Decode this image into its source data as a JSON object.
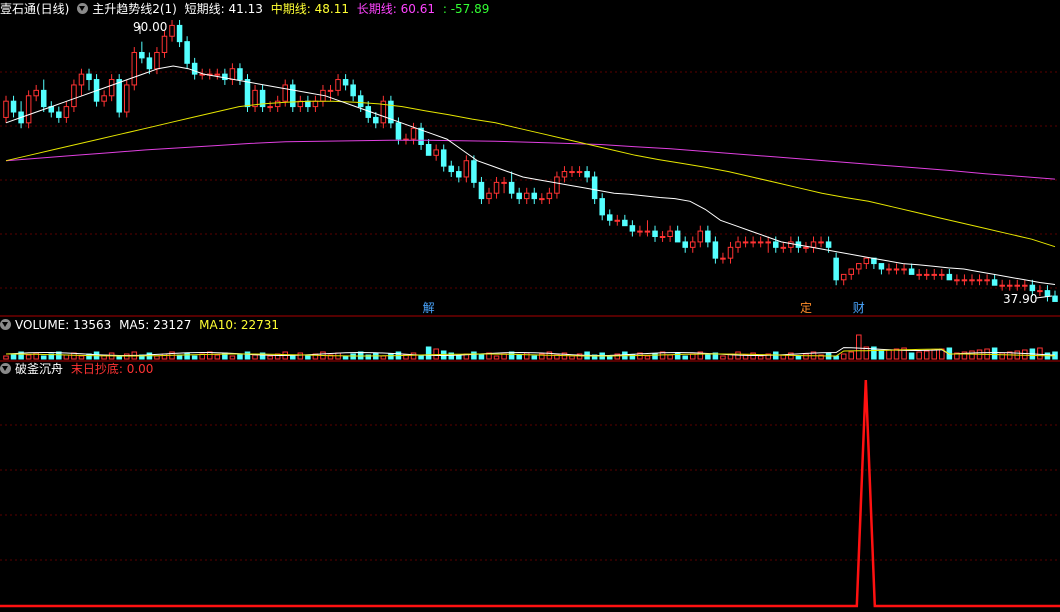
{
  "main": {
    "app_title": "壹石通(日线)",
    "indicator_name": "主升趋势线2(1)",
    "short_label": "短期线:",
    "short_value": "41.13",
    "mid_label": "中期线:",
    "mid_value": "48.11",
    "long_label": "长期线:",
    "long_value": "60.61",
    "extra_value": ": -57.89",
    "high_label": "90.00",
    "low_label": "37.90",
    "markers": [
      {
        "text": "解",
        "color": "#4aa6ff",
        "bar": 56
      },
      {
        "text": "定",
        "color": "#ff8c2a",
        "bar": 106
      },
      {
        "text": "财",
        "color": "#4aa6ff",
        "bar": 113
      }
    ]
  },
  "volume": {
    "title": "VOLUME: 13563",
    "ma5": "MA5: 23127",
    "ma10": "MA10: 22731"
  },
  "lower": {
    "title": "破釜沉舟",
    "series_label": "末日抄底: 0.00"
  },
  "colors": {
    "up": "#ff3333",
    "down": "#54ffff",
    "ma_short": "#ffffff",
    "ma_mid": "#e6e600",
    "ma_long": "#e040e0",
    "mid_text": "#ffff33",
    "long_text": "#ff44ff",
    "extra_text": "#33ff33",
    "signal": "#ff1111",
    "grid": "#5a0000"
  },
  "chart_data": [
    {
      "type": "candlestick",
      "title": "主升趋势线2(1)",
      "ylim": [
        37.9,
        90.0
      ],
      "series_names": [
        "短期线",
        "中期线",
        "长期线"
      ],
      "ohlc": [
        [
          72,
          76,
          71,
          75
        ],
        [
          75,
          76,
          72,
          73
        ],
        [
          73,
          75,
          70,
          71
        ],
        [
          71,
          77,
          70,
          76
        ],
        [
          76,
          78,
          75,
          77
        ],
        [
          77,
          79,
          73,
          74
        ],
        [
          74,
          75,
          72,
          73
        ],
        [
          73,
          74,
          71,
          72
        ],
        [
          72,
          75,
          71,
          74
        ],
        [
          74,
          79,
          73,
          78
        ],
        [
          78,
          81,
          76,
          80
        ],
        [
          80,
          81,
          77,
          79
        ],
        [
          79,
          80,
          74,
          75
        ],
        [
          75,
          77,
          74,
          76
        ],
        [
          76,
          80,
          75,
          79
        ],
        [
          79,
          80,
          72,
          73
        ],
        [
          73,
          79,
          72,
          78
        ],
        [
          78,
          85,
          77,
          84
        ],
        [
          84,
          86,
          82,
          83
        ],
        [
          83,
          84,
          80,
          81
        ],
        [
          81,
          85,
          80,
          84
        ],
        [
          84,
          88,
          83,
          87
        ],
        [
          87,
          90,
          86,
          89
        ],
        [
          89,
          90,
          85,
          86
        ],
        [
          86,
          87,
          81,
          82
        ],
        [
          82,
          83,
          79,
          80
        ],
        [
          80,
          81,
          79,
          80
        ],
        [
          80,
          81,
          79,
          80
        ],
        [
          80,
          81,
          79,
          80
        ],
        [
          80,
          81,
          78,
          79
        ],
        [
          79,
          82,
          78,
          81
        ],
        [
          81,
          82,
          78,
          79
        ],
        [
          79,
          80,
          73,
          74
        ],
        [
          74,
          78,
          73,
          77
        ],
        [
          77,
          78,
          73,
          74
        ],
        [
          74,
          75,
          73,
          74
        ],
        [
          74,
          76,
          73,
          75
        ],
        [
          75,
          79,
          74,
          78
        ],
        [
          78,
          79,
          73,
          74
        ],
        [
          74,
          76,
          73,
          75
        ],
        [
          75,
          76,
          73,
          74
        ],
        [
          74,
          76,
          73,
          75
        ],
        [
          75,
          78,
          74,
          77
        ],
        [
          77,
          78,
          75,
          77
        ],
        [
          77,
          80,
          76,
          79
        ],
        [
          79,
          80,
          77,
          78
        ],
        [
          78,
          79,
          75,
          76
        ],
        [
          76,
          77,
          73,
          74
        ],
        [
          74,
          75,
          71,
          72
        ],
        [
          72,
          73,
          70,
          71
        ],
        [
          71,
          76,
          70,
          75
        ],
        [
          75,
          76,
          70,
          71
        ],
        [
          71,
          72,
          67,
          68
        ],
        [
          68,
          69,
          67,
          68
        ],
        [
          68,
          71,
          67,
          70
        ],
        [
          70,
          71,
          66,
          67
        ],
        [
          67,
          68,
          65,
          65
        ],
        [
          65,
          67,
          64,
          66
        ],
        [
          66,
          67,
          62,
          63
        ],
        [
          63,
          64,
          61,
          62
        ],
        [
          62,
          63,
          60,
          61
        ],
        [
          61,
          65,
          60,
          64
        ],
        [
          64,
          65,
          59,
          60
        ],
        [
          60,
          61,
          56,
          57
        ],
        [
          57,
          59,
          56,
          58
        ],
        [
          58,
          61,
          57,
          60
        ],
        [
          60,
          61,
          58,
          60
        ],
        [
          60,
          62,
          57,
          58
        ],
        [
          58,
          59,
          56,
          57
        ],
        [
          57,
          59,
          56,
          58
        ],
        [
          58,
          59,
          56,
          57
        ],
        [
          57,
          58,
          56,
          57
        ],
        [
          57,
          59,
          56,
          58
        ],
        [
          58,
          62,
          57,
          61
        ],
        [
          61,
          63,
          60,
          62
        ],
        [
          62,
          63,
          61,
          62
        ],
        [
          62,
          63,
          61,
          62
        ],
        [
          62,
          63,
          60,
          61
        ],
        [
          61,
          62,
          56,
          57
        ],
        [
          57,
          58,
          53,
          54
        ],
        [
          54,
          55,
          52,
          53
        ],
        [
          53,
          54,
          52,
          53
        ],
        [
          53,
          54,
          52,
          52
        ],
        [
          52,
          53,
          50,
          51
        ],
        [
          51,
          52,
          50,
          51
        ],
        [
          51,
          53,
          50,
          51
        ],
        [
          51,
          52,
          49,
          50
        ],
        [
          50,
          51,
          49,
          50
        ],
        [
          50,
          52,
          49,
          51
        ],
        [
          51,
          52,
          49,
          49
        ],
        [
          49,
          50,
          47,
          48
        ],
        [
          48,
          50,
          47,
          49
        ],
        [
          49,
          52,
          48,
          51
        ],
        [
          51,
          52,
          48,
          49
        ],
        [
          49,
          50,
          45,
          46
        ],
        [
          46,
          47,
          45,
          46
        ],
        [
          46,
          49,
          45,
          48
        ],
        [
          48,
          50,
          47,
          49
        ],
        [
          49,
          50,
          48,
          49
        ],
        [
          49,
          50,
          48,
          49
        ],
        [
          49,
          50,
          48,
          49
        ],
        [
          49,
          50,
          47,
          49
        ],
        [
          49,
          50,
          47,
          48
        ],
        [
          48,
          49,
          47,
          48
        ],
        [
          48,
          50,
          47,
          49
        ],
        [
          49,
          50,
          47,
          48
        ],
        [
          48,
          49,
          47,
          48
        ],
        [
          48,
          50,
          47,
          49
        ],
        [
          49,
          50,
          48,
          49
        ],
        [
          49,
          50,
          47,
          48
        ],
        [
          48,
          50,
          47,
          49
        ],
        [
          49,
          50,
          48,
          49
        ],
        [
          49,
          50,
          47,
          48
        ],
        [
          48,
          49,
          44,
          45
        ],
        [
          45,
          46,
          44,
          45
        ],
        [
          45,
          46,
          44,
          45
        ],
        [
          45,
          46,
          44,
          45
        ],
        [
          45,
          46,
          44,
          45
        ],
        [
          45,
          46,
          44,
          45
        ],
        [
          45,
          46,
          44,
          45
        ],
        [
          45,
          46,
          44,
          45
        ],
        [
          45,
          46,
          44,
          45
        ],
        [
          45,
          46,
          44,
          45
        ],
        [
          45,
          46,
          44,
          45
        ],
        [
          45,
          46,
          44,
          45
        ],
        [
          45,
          46,
          44,
          45
        ],
        [
          45,
          46,
          44,
          45
        ],
        [
          45,
          46,
          44,
          45
        ],
        [
          45,
          46,
          44,
          45
        ],
        [
          45,
          46,
          44,
          45
        ],
        [
          45,
          46,
          44,
          45
        ],
        [
          45,
          46,
          44,
          45
        ],
        [
          45,
          46,
          44,
          45
        ],
        [
          45,
          46,
          44,
          45
        ],
        [
          45,
          46,
          44,
          45
        ],
        [
          45,
          46,
          44,
          45
        ],
        [
          45,
          46,
          44,
          45
        ],
        [
          45,
          46,
          44,
          45
        ],
        [
          45,
          46,
          44,
          45
        ],
        [
          45,
          46,
          44,
          45
        ]
      ],
      "ohlc_tail": [
        [
          46,
          47,
          41,
          42
        ],
        [
          42,
          43,
          41,
          43
        ],
        [
          43,
          44,
          42,
          44
        ],
        [
          44,
          45,
          43,
          45
        ],
        [
          45,
          46,
          44,
          46
        ],
        [
          46,
          46,
          44,
          45
        ],
        [
          45,
          45,
          43,
          44
        ],
        [
          44,
          45,
          43,
          44
        ],
        [
          44,
          45,
          43,
          44
        ],
        [
          44,
          45,
          43,
          44
        ],
        [
          44,
          45,
          43,
          43
        ],
        [
          43,
          44,
          42,
          43
        ],
        [
          43,
          44,
          42,
          43
        ],
        [
          43,
          44,
          42,
          43
        ],
        [
          43,
          44,
          42,
          43
        ],
        [
          43,
          44,
          42,
          42
        ],
        [
          42,
          43,
          41,
          42
        ],
        [
          42,
          43,
          41,
          42
        ],
        [
          42,
          43,
          41,
          42
        ],
        [
          42,
          43,
          41,
          42
        ],
        [
          42,
          43,
          41,
          42
        ],
        [
          42,
          43,
          41,
          41
        ],
        [
          41,
          42,
          40,
          41
        ],
        [
          41,
          42,
          40,
          41
        ],
        [
          41,
          42,
          40,
          41
        ],
        [
          41,
          42,
          40,
          41
        ],
        [
          41,
          42,
          39,
          40
        ],
        [
          40,
          41,
          39,
          40
        ],
        [
          40,
          41,
          38,
          39
        ],
        [
          39,
          40,
          38,
          38
        ]
      ],
      "ma_short": [
        71.0,
        72.0,
        73.0,
        74.0,
        75.0,
        76.0,
        77.0,
        78.0,
        79.0,
        80.0,
        81.0,
        81.5,
        81.0,
        80.0,
        79.5,
        79.0,
        78.5,
        78.0,
        77.5,
        77.0,
        76.5,
        76.0,
        75.0,
        74.0,
        73.0,
        72.0,
        71.0,
        70.0,
        69.0,
        68.0,
        66.0,
        64.0,
        63.0,
        62.0,
        61.0,
        60.5,
        60.0,
        59.5,
        59.0,
        58.5,
        58.0,
        57.8,
        57.5,
        57.2,
        57.0,
        56.5,
        55.0,
        53.0,
        52.0,
        51.0,
        50.0,
        49.0,
        48.5,
        48.0,
        47.5,
        47.0,
        46.5,
        46.0,
        45.5,
        45.0,
        44.8,
        44.5,
        44.2,
        44.0,
        43.5,
        43.0,
        42.5,
        42.0,
        41.5,
        41.13
      ],
      "ma_mid": [
        64.0,
        65.0,
        66.0,
        67.0,
        68.0,
        69.0,
        70.0,
        71.0,
        72.0,
        73.0,
        74.0,
        74.5,
        74.8,
        75.0,
        75.0,
        74.8,
        74.5,
        74.0,
        73.2,
        72.5,
        71.7,
        71.0,
        70.0,
        69.0,
        68.0,
        67.0,
        66.0,
        65.0,
        64.2,
        63.5,
        62.8,
        62.0,
        61.0,
        60.0,
        59.0,
        58.0,
        57.2,
        56.5,
        55.5,
        54.5,
        53.5,
        52.5,
        51.5,
        50.5,
        49.5,
        48.11
      ],
      "ma_long": [
        64.0,
        64.5,
        65.0,
        65.5,
        66.0,
        66.4,
        66.8,
        67.2,
        67.5,
        67.6,
        67.7,
        67.8,
        67.8,
        67.7,
        67.6,
        67.4,
        67.2,
        67.0,
        66.6,
        66.2,
        65.7,
        65.2,
        64.7,
        64.2,
        63.7,
        63.2,
        62.7,
        62.2,
        61.6,
        61.1,
        60.61
      ]
    },
    {
      "type": "bar",
      "title": "VOLUME: 13563",
      "series_names": [
        "VOLUME",
        "MA5",
        "MA10"
      ],
      "last_values": {
        "VOLUME": 13563,
        "MA5": 23127,
        "MA10": 22731
      }
    },
    {
      "type": "line",
      "title": "破釜沉舟",
      "series_names": [
        "末日抄底"
      ],
      "baseline": 0,
      "spike_bar": 113,
      "spike_value": 100,
      "last_value": 0.0
    }
  ]
}
